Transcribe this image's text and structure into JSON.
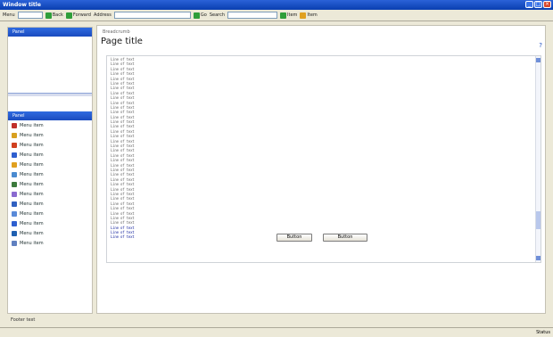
{
  "window": {
    "title": "Window title",
    "buttons": [
      "_",
      "□",
      "×"
    ]
  },
  "toolbar": {
    "menu_label": "Menu",
    "address_value": "",
    "back_label": "Back",
    "forward_label": "Forward",
    "address_label": "Address",
    "go_label": "Go",
    "search_label": "Search",
    "search_value": "",
    "right_items": [
      "Item",
      "Item"
    ],
    "icon_colors": {
      "back": "#2f9e3a",
      "forward": "#2f9e3a",
      "go": "#2f9e3a",
      "search": "#3b6fd8",
      "item": "#e0a020"
    }
  },
  "sidebar": {
    "login_title": "Panel",
    "login_text": "",
    "menu_title": "Panel",
    "items": [
      {
        "label": "Menu item",
        "icon": "star-icon",
        "color": "#c0302a"
      },
      {
        "label": "Menu item",
        "icon": "folder-icon",
        "color": "#d8a020"
      },
      {
        "label": "Menu item",
        "icon": "document-icon",
        "color": "#d04020"
      },
      {
        "label": "Menu item",
        "icon": "grid-icon",
        "color": "#2e5fcf"
      },
      {
        "label": "Menu item",
        "icon": "box-icon",
        "color": "#e0a020"
      },
      {
        "label": "Menu item",
        "icon": "globe-icon",
        "color": "#4a8bd0"
      },
      {
        "label": "Menu item",
        "icon": "user-icon",
        "color": "#3c7a3c"
      },
      {
        "label": "Menu item",
        "icon": "search-icon",
        "color": "#8a6ad0"
      },
      {
        "label": "Menu item",
        "icon": "link-icon",
        "color": "#3060c0"
      },
      {
        "label": "Menu item",
        "icon": "calendar-icon",
        "color": "#5a8ad8"
      },
      {
        "label": "Menu item",
        "icon": "person-icon",
        "color": "#2e5fcf"
      },
      {
        "label": "Menu item",
        "icon": "people-icon",
        "color": "#2060b0"
      },
      {
        "label": "Menu item",
        "icon": "clipboard-icon",
        "color": "#6080c0"
      }
    ]
  },
  "main": {
    "breadcrumb": "Breadcrumb",
    "page_title": "Page title",
    "help_icon": "?",
    "code_lines": [
      "Line of text",
      "Line of text",
      "Line of text",
      "Line of text",
      "Line of text",
      "Line of text",
      "Line of text",
      "Line of text",
      "Line of text",
      "Line of text",
      "Line of text",
      "Line of text",
      "Line of text",
      "Line of text",
      "Line of text",
      "Line of text",
      "Line of text",
      "Line of text",
      "Line of text",
      "Line of text",
      "Line of text",
      "Line of text",
      "Line of text",
      "Line of text",
      "Line of text",
      "Line of text",
      "Line of text",
      "Line of text",
      "Line of text",
      "Line of text",
      "Line of text",
      "Line of text",
      "Line of text",
      "Line of text",
      "Line of text",
      "Line of text",
      "Line of text",
      "Line of text"
    ],
    "highlight_from": 35,
    "cancel_label": "Button",
    "save_label": "Button"
  },
  "footer": {
    "text": "Footer text"
  },
  "statusbar": {
    "left_text": "",
    "right_text": "Status"
  }
}
